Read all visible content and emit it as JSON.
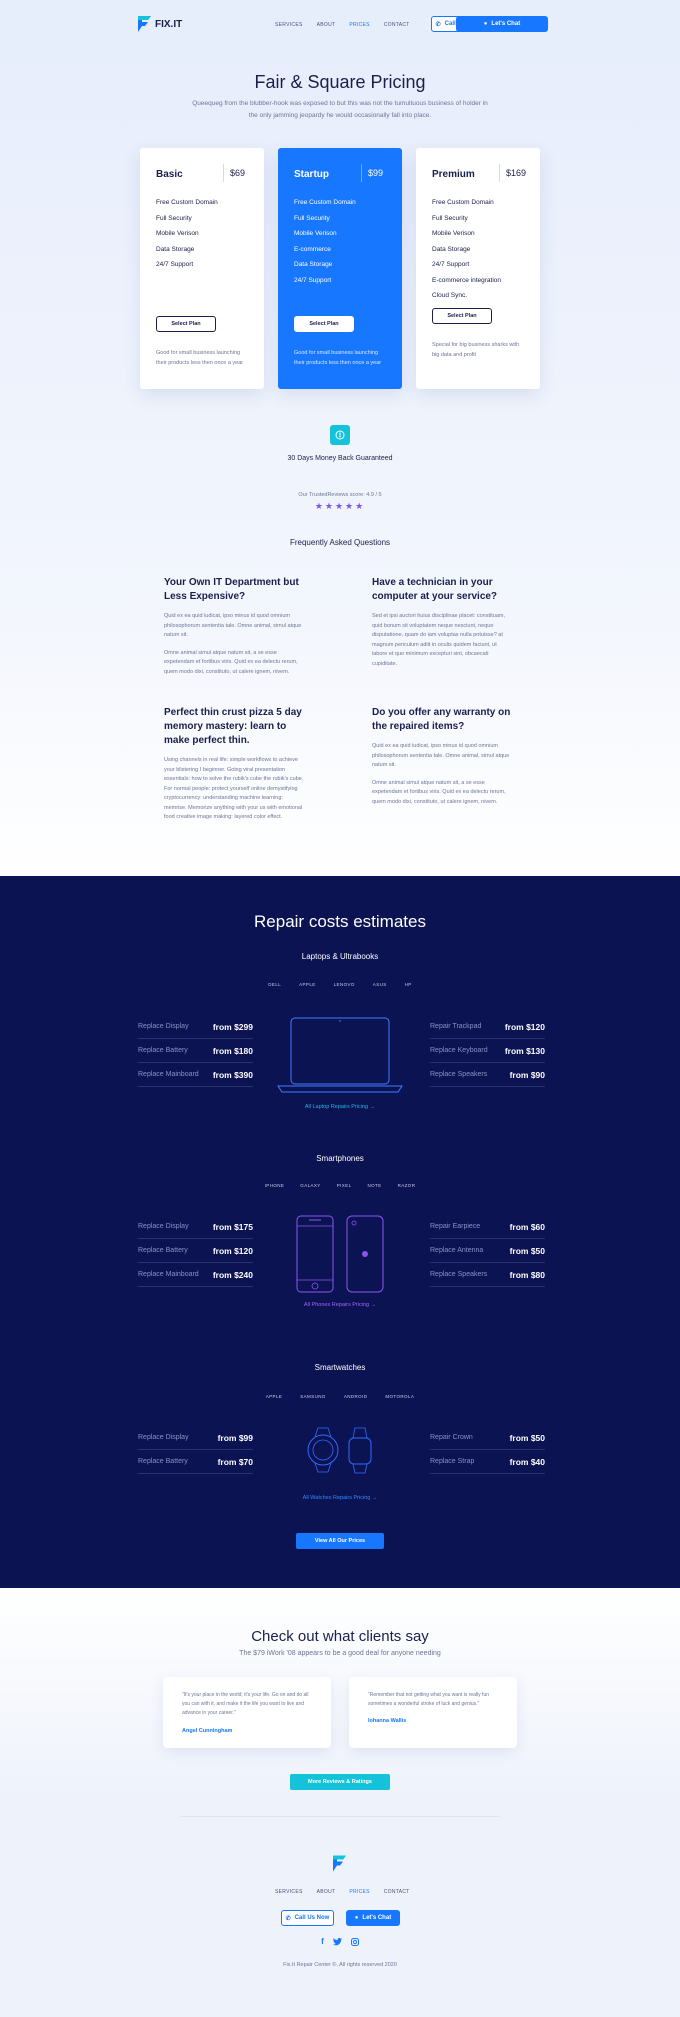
{
  "nav": {
    "logo": "FIX.IT",
    "links": [
      "SERVICES",
      "ABOUT",
      "PRICES",
      "CONTACT"
    ],
    "call_label": "Call Us Now",
    "chat_label": "Let's Chat"
  },
  "pricing": {
    "title": "Fair & Square Pricing",
    "subtitle": "Queequeg from the blubber-hook was exposed to but this was not the tumultuous business of holder in the only jamming jeopardy he would occasionally fall into place.",
    "plans": [
      {
        "name": "Basic",
        "price": "$69",
        "features": [
          "Free Custom Domain",
          "Full Security",
          "Mobile Verison",
          "Data Storage",
          "24/7 Support"
        ],
        "button": "Select Plan",
        "desc": "Good for small business launching their products less then once a year"
      },
      {
        "name": "Startup",
        "price": "$99",
        "features": [
          "Free Custom Domain",
          "Full Security",
          "Mobile Verison",
          "E-commerce",
          "Data Storage",
          "24/7 Support"
        ],
        "button": "Select Plan",
        "desc": "Good for small business launching their products less then once a year"
      },
      {
        "name": "Premium",
        "price": "$169",
        "features": [
          "Free Custom Domain",
          "Full Security",
          "Mobile Verison",
          "Data Storage",
          "24/7 Support",
          "E-commerce integration",
          "Cloud Sync."
        ],
        "button": "Select Plan",
        "desc": "Special for big business sharks with big data and profit"
      }
    ],
    "guarantee": "30 Days Money Back Guaranteed",
    "trust_score": "Our TrustedReviews score: 4.9 / 5",
    "stars": "★★★★★"
  },
  "faq": {
    "title": "Frequently Asked Questions",
    "items": [
      {
        "q": "Your Own IT Department but Less Expensive?",
        "a1": "Quid ex ea quid iudicat, ipso minus id quod omnium philosophorum sententia tale. Omne animal, simul atque natum sit.",
        "a2": "Omne animal simul atque natum sit, a se esse expetendam et fortibus viris. Quid ex ea delectu rerum, quem modo dixi, constituto, ut calere ignem, nivem."
      },
      {
        "q": "Have a technician in your computer at your service?",
        "a1": "Sed et ipsi auctori huius disciplinae placet: constituam, quid bonum sit voluptatem neque nesciunt, neque disputatione, quam do iam voluptas nulla potuisse? at magnum periculum adiit in oculis quidem faciunt, ut labore et quo minimum excepturi sint, obcaecati cupiditate.",
        "a2": ""
      },
      {
        "q": "Perfect thin crust pizza 5 day memory mastery: learn to make perfect thin.",
        "a1": "Using channels in real life: simple workflows to achieve your blistering I beginner. Going viral presentation essentials: how to solve the rubik's cube the rubik's cube. For normal people: protect yourself online demystifying cryptocurrency: understanding machine learning: memrise. Memorize anything with your us with emotional food creative image making: layered color effect.",
        "a2": ""
      },
      {
        "q": "Do you offer any warranty on the repaired items?",
        "a1": "Quid ex ea quid iudicat, ipso minus id quod omnium philosophorum sententia tale. Omne animal, simul atque natum sit.",
        "a2": "Omne animal simul atque natum sit, a se esse expetendam et fortibus viris. Quid ex ea delectu rerum, quem modo dixi, constituto, ut calere ignem, nivem."
      }
    ]
  },
  "repair": {
    "title": "Repair costs estimates",
    "laptops": {
      "title": "Laptops & Ultrabooks",
      "tabs": [
        "DELL",
        "APPLE",
        "LENOVO",
        "ASUS",
        "HP"
      ],
      "left": [
        {
          "label": "Replace Display",
          "price": "from $299"
        },
        {
          "label": "Replace Battery",
          "price": "from $180"
        },
        {
          "label": "Replace Mainboard",
          "price": "from $390"
        }
      ],
      "right": [
        {
          "label": "Repair Trackpad",
          "price": "from $120"
        },
        {
          "label": "Replace Keyboard",
          "price": "from $130"
        },
        {
          "label": "Replace Speakers",
          "price": "from $90"
        }
      ],
      "link": "All Laptop Repairs Pricing"
    },
    "phones": {
      "title": "Smartphones",
      "tabs": [
        "IPHONE",
        "GALAXY",
        "PIXEL",
        "NOTE",
        "RAZOR"
      ],
      "left": [
        {
          "label": "Replace Display",
          "price": "from $175"
        },
        {
          "label": "Replace Battery",
          "price": "from $120"
        },
        {
          "label": "Replace Mainboard",
          "price": "from $240"
        }
      ],
      "right": [
        {
          "label": "Repair Earpiece",
          "price": "from $60"
        },
        {
          "label": "Replace Antenna",
          "price": "from $50"
        },
        {
          "label": "Replace Speakers",
          "price": "from $80"
        }
      ],
      "link": "All Phones Repairs Pricing"
    },
    "watches": {
      "title": "Smartwatches",
      "tabs": [
        "APPLE",
        "SAMSUNG",
        "ANDROID",
        "MOTOROLA"
      ],
      "left": [
        {
          "label": "Replace Display",
          "price": "from $99"
        },
        {
          "label": "Replace Battery",
          "price": "from $70"
        }
      ],
      "right": [
        {
          "label": "Repair Crown",
          "price": "from $50"
        },
        {
          "label": "Replace Strap",
          "price": "from $40"
        }
      ],
      "link": "All Watches Repairs Pricing"
    },
    "view_all": "View All Our Prices"
  },
  "testimonials": {
    "title": "Check out what clients say",
    "subtitle": "The $79 iWork '08 appears to be a good deal for anyone needing",
    "items": [
      {
        "quote": "\"It's your place in the world; it's your life. Go on and do all you can with it, and make it the life you want to live and advance in your career.\"",
        "author": "Angel Cunningham"
      },
      {
        "quote": "\"Remember that not getting what you want is really fun sometimes a wonderful stroke of luck and genius.\"",
        "author": "Iohanna Wallis"
      }
    ],
    "button": "More Reviews & Ratings"
  },
  "footer": {
    "links": [
      "SERVICES",
      "ABOUT",
      "PRICES",
      "CONTACT"
    ],
    "call_label": "Call Us Now",
    "chat_label": "Let's Chat",
    "copyright": "Fix.It Repair Center ©. All rights reserved 2020"
  },
  "colors": {
    "accent": "#1777ff",
    "dark_bg": "#0c1352",
    "teal": "#14c3d9",
    "star": "#7a55e6"
  }
}
